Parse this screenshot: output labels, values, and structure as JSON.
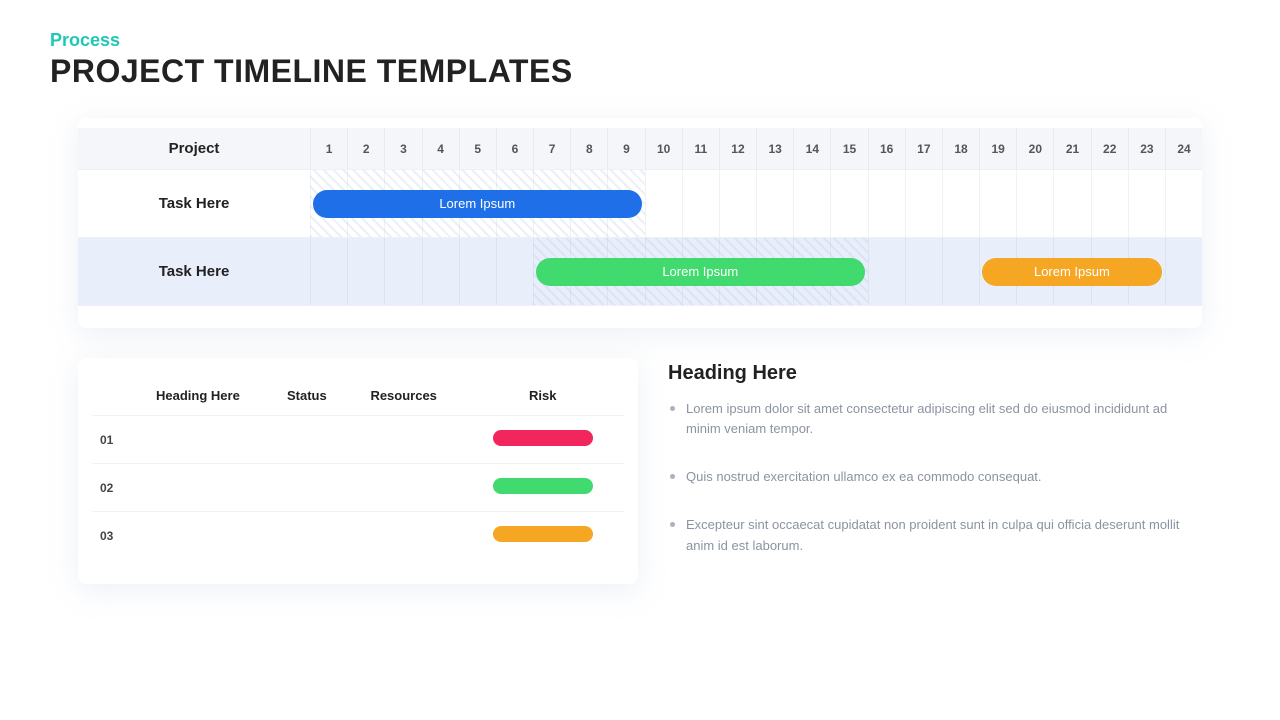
{
  "eyebrow": "Process",
  "title": "PROJECT TIMELINE TEMPLATES",
  "gantt": {
    "label_header": "Project",
    "columns": [
      "1",
      "2",
      "3",
      "4",
      "5",
      "6",
      "7",
      "8",
      "9",
      "10",
      "11",
      "12",
      "13",
      "14",
      "15",
      "16",
      "17",
      "18",
      "19",
      "20",
      "21",
      "22",
      "23",
      "24"
    ],
    "rows": [
      {
        "label": "Task Here",
        "alt": false,
        "hatch": {
          "start": 1,
          "end": 9
        },
        "bars": [
          {
            "label": "Lorem Ipsum",
            "start": 1,
            "end": 9,
            "color": "#1f6fe8"
          }
        ]
      },
      {
        "label": "Task Here",
        "alt": true,
        "hatch": {
          "start": 7,
          "end": 15
        },
        "bars": [
          {
            "label": "Lorem Ipsum",
            "start": 7,
            "end": 15,
            "color": "#40da6f"
          },
          {
            "label": "Lorem Ipsum",
            "start": 19,
            "end": 23,
            "color": "#f5a623"
          }
        ]
      }
    ]
  },
  "table": {
    "headers": [
      "Heading Here",
      "Status",
      "Resources",
      "Risk"
    ],
    "rows": [
      {
        "idx": "01",
        "cells": [
          "",
          "",
          ""
        ],
        "risk_color": "#f0265c"
      },
      {
        "idx": "02",
        "cells": [
          "",
          "",
          ""
        ],
        "risk_color": "#40da6f"
      },
      {
        "idx": "03",
        "cells": [
          "",
          "",
          ""
        ],
        "risk_color": "#f5a623"
      }
    ]
  },
  "text": {
    "heading": "Heading Here",
    "bullets": [
      "Lorem ipsum dolor sit amet consectetur adipiscing elit sed do eiusmod incididunt ad minim veniam tempor.",
      "Quis nostrud exercitation ullamco ex ea commodo consequat.",
      "Excepteur sint occaecat cupidatat non proident sunt in culpa qui officia deserunt mollit anim id est laborum."
    ]
  },
  "colors": {
    "eyebrow": "#1fc7b6",
    "row_alt": "#e9eefb"
  }
}
